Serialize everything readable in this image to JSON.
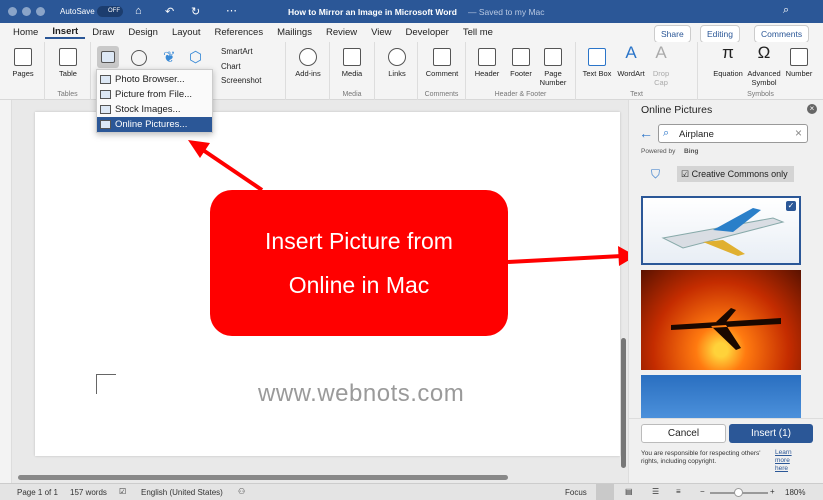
{
  "titlebar": {
    "autosave": "AutoSave",
    "toggle": "OFF",
    "title": "How to Mirror an Image in Microsoft Word",
    "saved": "— Saved to my Mac"
  },
  "tabs": [
    "Home",
    "Insert",
    "Draw",
    "Design",
    "Layout",
    "References",
    "Mailings",
    "Review",
    "View",
    "Developer",
    "Tell me"
  ],
  "actions": {
    "share": "Share",
    "editing": "Editing",
    "comments": "Comments"
  },
  "ribbon": {
    "pages": "Pages",
    "table": "Table",
    "tables_group": "Tables",
    "smartart": "SmartArt",
    "chart": "Chart",
    "screenshot": "Screenshot",
    "addins": "Add-ins",
    "media": "Media",
    "media_group": "Media",
    "links": "Links",
    "comment": "Comment",
    "comments_group": "Comments",
    "header": "Header",
    "footer": "Footer",
    "page_number": "Page Number",
    "hf_group": "Header & Footer",
    "textbox": "Text Box",
    "wordart": "WordArt",
    "dropcap": "Drop Cap",
    "text_group": "Text",
    "equation": "Equation",
    "advsymbol": "Advanced Symbol",
    "number": "Number",
    "symbols_group": "Symbols"
  },
  "picture_menu": [
    "Photo Browser...",
    "Picture from File...",
    "Stock Images...",
    "Online Pictures..."
  ],
  "callout": {
    "line1": "Insert Picture from",
    "line2": "Online in Mac"
  },
  "watermark": "www.webnots.com",
  "pane": {
    "title": "Online Pictures",
    "search_value": "Airplane",
    "powered": "Powered by",
    "bing": "Bing",
    "cc_label": "Creative Commons only",
    "cancel": "Cancel",
    "insert": "Insert (1)",
    "notice": "You are responsible for respecting others' rights, including copyright.",
    "learn": "Learn more here"
  },
  "status": {
    "page": "Page 1 of 1",
    "words": "157 words",
    "language": "English (United States)",
    "focus": "Focus",
    "zoom": "180%",
    "zoom_level": 180
  },
  "colors": {
    "accent": "#2b5797",
    "callout": "#ff0000"
  }
}
